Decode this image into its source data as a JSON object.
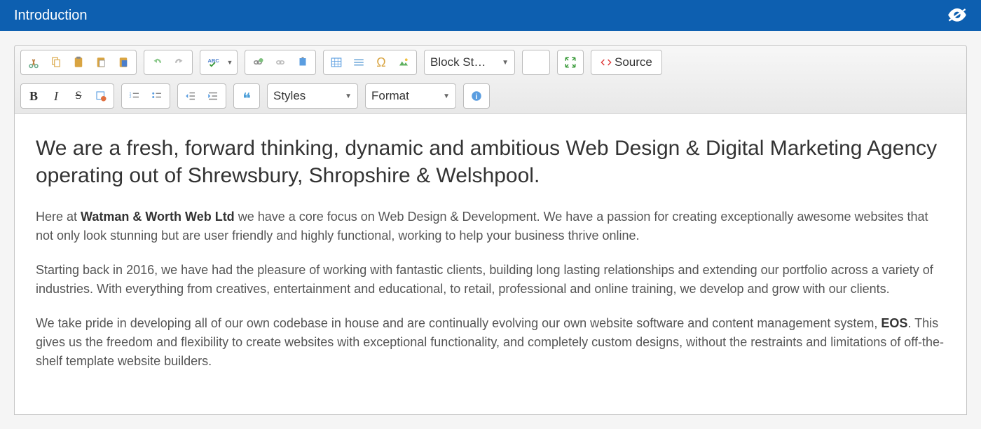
{
  "header": {
    "title": "Introduction"
  },
  "toolbar": {
    "block_styles": "Block St…",
    "source": "Source",
    "styles": "Styles",
    "format": "Format"
  },
  "content": {
    "heading": "We are a fresh, forward thinking, dynamic and ambitious Web Design & Digital Marketing Agency operating out of Shrewsbury, Shropshire & Welshpool.",
    "p1_pre": "Here at ",
    "p1_bold": "Watman & Worth Web Ltd",
    "p1_post": " we have a core focus on Web Design & Development. We have a passion for creating exceptionally awesome websites that not only look stunning but are user friendly and highly functional, working to help your business thrive online.",
    "p2": "Starting back in 2016, we have had the pleasure of working with fantastic clients, building long lasting relationships and extending our portfolio across a variety of industries. With everything from creatives, entertainment and educational, to retail, professional and online training, we develop and grow with our clients.",
    "p3_pre": "We take pride in developing all of our own codebase in house and are continually evolving our own website software and content management system, ",
    "p3_bold": "EOS",
    "p3_post": ". This gives us the freedom and flexibility to create websites with exceptional functionality, and completely custom designs, without the restraints and limitations of off-the-shelf template website builders."
  }
}
